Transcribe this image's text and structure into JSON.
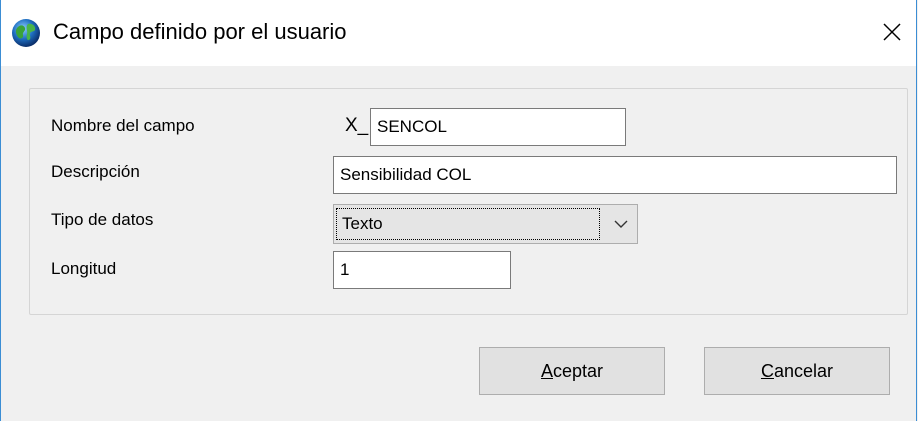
{
  "window": {
    "title": "Campo definido por el usuario",
    "icon": "globe-icon",
    "close_icon": "close-icon"
  },
  "form": {
    "field_name": {
      "label": "Nombre del campo",
      "prefix": "X_",
      "value": "SENCOL"
    },
    "description": {
      "label": "Descripción",
      "value": "Sensibilidad COL"
    },
    "data_type": {
      "label": "Tipo de datos",
      "selected": "Texto"
    },
    "length": {
      "label": "Longitud",
      "value": "1"
    }
  },
  "buttons": {
    "accept": {
      "accel": "A",
      "rest": "ceptar"
    },
    "cancel": {
      "accel": "C",
      "rest": "ancelar"
    }
  },
  "colors": {
    "window_border": "#3b8dd4",
    "dialog_background": "#f0f0f0",
    "button_face": "#e1e1e1"
  }
}
